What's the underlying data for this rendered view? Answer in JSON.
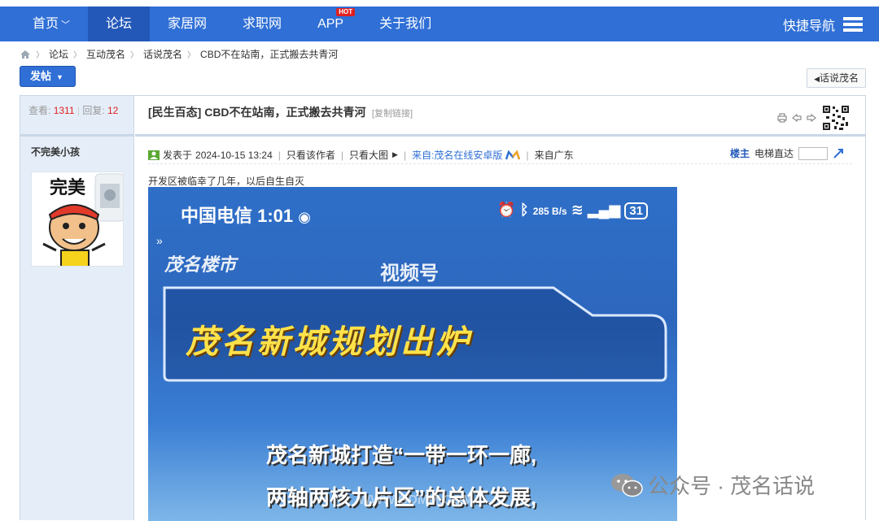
{
  "nav": {
    "items": [
      {
        "label": "首页",
        "chevron": "﹀"
      },
      {
        "label": "论坛"
      },
      {
        "label": "家居网"
      },
      {
        "label": "求职网"
      },
      {
        "label": "APP",
        "badge": "HOT"
      },
      {
        "label": "关于我们"
      }
    ],
    "quick_nav": "快捷导航",
    "colors": {
      "bar": "#2f6fd6",
      "active": "#2358b8",
      "hot": "#e02020"
    }
  },
  "breadcrumb": [
    "论坛",
    "互动茂名",
    "话说茂名",
    "CBD不在站南，正式搬去共青河"
  ],
  "buttons": {
    "post": "发帖",
    "back": "话说茂名"
  },
  "stats": {
    "views_label": "查看:",
    "views": "1311",
    "replies_label": "回复:",
    "replies": "12"
  },
  "thread": {
    "title": "[民生百态] CBD不在站南，正式搬去共青河",
    "copy_link": "[复制链接]"
  },
  "post": {
    "author": "不完美小孩",
    "avatar_text": "完美",
    "posted_prefix": "发表于",
    "posted_at": "2024-10-15 13:24",
    "only_author": "只看该作者",
    "only_big": "只看大图",
    "source": "来自:茂名在线安卓版",
    "location": "来自广东",
    "floor_label": "楼主",
    "jump_label": "电梯直达",
    "body": "开发区被临幸了几年，以后自生自灭"
  },
  "image": {
    "carrier": "中国电信 1:01",
    "net_speed": "285 B/s",
    "battery": "31",
    "logo": "茂名楼市",
    "channel": "视频号",
    "headline": "茂名新城规划出炉",
    "line1": "茂名新城打造“一带一环一廊,",
    "line2": "两轴两核九片区”的总体发展,",
    "watermark": "WWW.GDMM.COM"
  },
  "wechat": {
    "text": "公众号 · 茂名话说"
  }
}
